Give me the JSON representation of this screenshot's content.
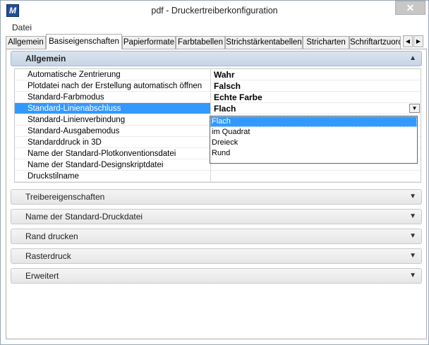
{
  "window": {
    "title": "pdf - Druckertreiberkonfiguration",
    "close_label": "✕",
    "icon_label": "M"
  },
  "menu": {
    "file_label": "Datei"
  },
  "tabs": [
    {
      "label": "Allgemein"
    },
    {
      "label": "Basiseigenschaften",
      "active": true
    },
    {
      "label": "Papierformate"
    },
    {
      "label": "Farbtabellen"
    },
    {
      "label": "Strichstärkentabellen"
    },
    {
      "label": "Stricharten"
    },
    {
      "label": "Schriftartzuord"
    }
  ],
  "tab_scroll": {
    "left": "◀",
    "right": "▶"
  },
  "sections": {
    "general": {
      "label": "Allgemein",
      "chevron": "▲"
    },
    "collapsed": [
      {
        "label": "Treibereigenschaften",
        "chevron": "▼"
      },
      {
        "label": "Name der Standard-Druckdatei",
        "chevron": "▼"
      },
      {
        "label": "Rand drucken",
        "chevron": "▼"
      },
      {
        "label": "Rasterdruck",
        "chevron": "▼"
      },
      {
        "label": "Erweitert",
        "chevron": "▼"
      }
    ]
  },
  "properties": [
    {
      "name": "Automatische Zentrierung",
      "value": "Wahr"
    },
    {
      "name": "Plotdatei nach der Erstellung automatisch öffnen",
      "value": "Falsch"
    },
    {
      "name": "Standard-Farbmodus",
      "value": "Echte Farbe"
    },
    {
      "name": "Standard-Linienabschluss",
      "value": "Flach",
      "selected": true
    },
    {
      "name": "Standard-Linienverbindung",
      "value": ""
    },
    {
      "name": "Standard-Ausgabemodus",
      "value": ""
    },
    {
      "name": "Standarddruck in 3D",
      "value": ""
    },
    {
      "name": "Name der Standard-Plotkonventionsdatei",
      "value": ""
    },
    {
      "name": "Name der Standard-Designskriptdatei",
      "value": ""
    },
    {
      "name": "Druckstilname",
      "value": ""
    }
  ],
  "dropdown": {
    "arrow": "▼",
    "options": [
      "Flach",
      "im Quadrat",
      "Dreieck",
      "Rund"
    ],
    "selected_index": 0
  }
}
